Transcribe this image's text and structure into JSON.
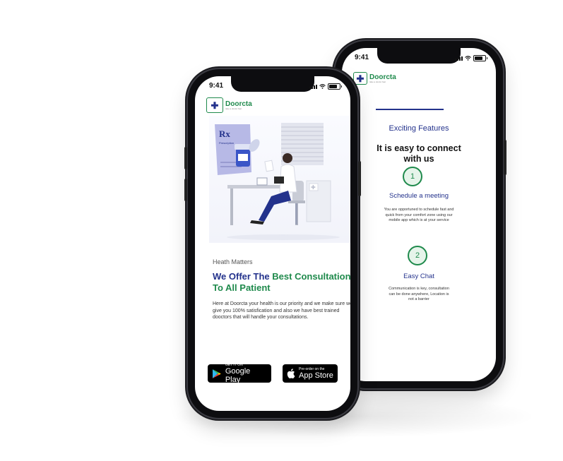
{
  "status_bar": {
    "time": "9:41"
  },
  "brand": {
    "name": "Doorcta",
    "tagline": "take a doctor fast"
  },
  "colors": {
    "navy": "#23328c",
    "green": "#1f8a4c"
  },
  "left_screen": {
    "hero_illustration": {
      "prescription_mark": "Rx",
      "prescription_label": "Prescription"
    },
    "eyebrow": "Heath Matters",
    "headline": {
      "part1": "We Offer The ",
      "part2": "Best Consultation To All Patient"
    },
    "body": "Here at Doorcta your health is our priority and we make sure we give you 100% satisfication and also we have best trained dooctors that will handle your consultations.",
    "google_play": {
      "small": "GET IT ON",
      "big": "Google Play",
      "icon": "google-play-icon"
    },
    "app_store": {
      "small": "Pre-order on the",
      "big": "App Store",
      "icon": "apple-icon"
    }
  },
  "right_screen": {
    "section_label": "Exciting Features",
    "heading_line1": "It is easy to connect",
    "heading_line2": "with us",
    "steps": [
      {
        "number": "1",
        "title": "Schedule a meeting",
        "description": "You are opportuned to schedule fast and quick from your comfort zone using our mobile app which is at your service"
      },
      {
        "number": "2",
        "title": "Easy Chat",
        "description": "Communication is key, consultation can be done anywhere, Location is not a barrier"
      }
    ]
  }
}
